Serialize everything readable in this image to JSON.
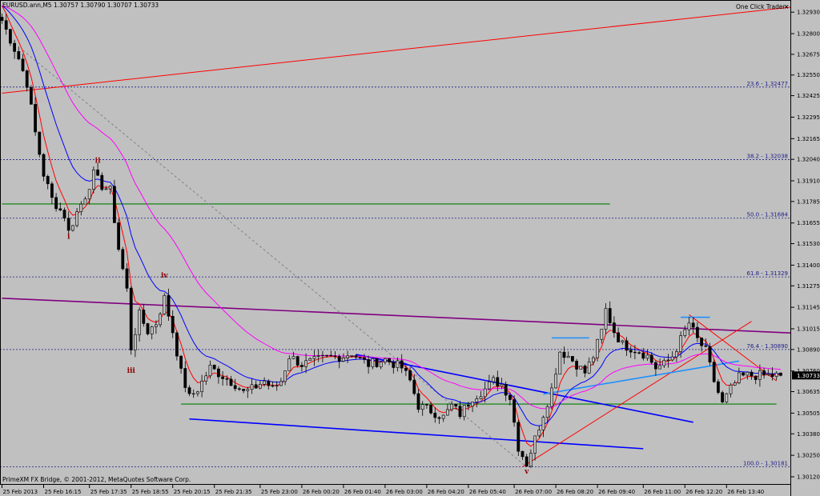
{
  "header": {
    "symbol_info": "EURUSD.ann,M5  1.30757 1.30790 1.30707 1.30733",
    "one_click_trader": "One Click Trader",
    "close_glyph": "×"
  },
  "footer": {
    "copyright": "PrimeXM FX Bridge, © 2001-2012, MetaQuotes Software Corp."
  },
  "colors": {
    "background": "#c0c0c0",
    "candle": "#000000",
    "ma_fast": "#ff0000",
    "ma_mid": "#0000ff",
    "ma_slow": "#ff00ff",
    "horizontal_green": "#008000",
    "purple_trend": "#800080",
    "red_trend": "#ff0000",
    "blue_trend": "#0000ff",
    "cyan": "#1e90ff",
    "fib_level": "#1c1c8c",
    "price_tag": "#000000"
  },
  "chart_data": {
    "type": "candlestick",
    "ylim": [
      1.3012,
      1.3296
    ],
    "x_range": [
      0,
      187
    ],
    "price_ticks": [
      "1.32930",
      "1.32800",
      "1.32675",
      "1.32550",
      "1.32425",
      "1.32295",
      "1.32165",
      "1.32040",
      "1.31910",
      "1.31785",
      "1.31655",
      "1.31530",
      "1.31400",
      "1.31275",
      "1.31145",
      "1.31015",
      "1.30890",
      "1.30760",
      "1.30635",
      "1.30505",
      "1.30380",
      "1.30250",
      "1.30120"
    ],
    "current_price": "1.30733",
    "time_ticks": [
      {
        "i": 0,
        "label": "25 Feb 2013"
      },
      {
        "i": 10,
        "label": "25 Feb 16:15"
      },
      {
        "i": 21,
        "label": "25 Feb 17:35"
      },
      {
        "i": 31,
        "label": "25 Feb 18:55"
      },
      {
        "i": 41,
        "label": "25 Feb 20:15"
      },
      {
        "i": 51,
        "label": "25 Feb 21:35"
      },
      {
        "i": 62,
        "label": "25 Feb 23:00"
      },
      {
        "i": 72,
        "label": "26 Feb 00:20"
      },
      {
        "i": 82,
        "label": "26 Feb 01:40"
      },
      {
        "i": 92,
        "label": "26 Feb 03:00"
      },
      {
        "i": 102,
        "label": "26 Feb 04:20"
      },
      {
        "i": 112,
        "label": "26 Feb 05:40"
      },
      {
        "i": 123,
        "label": "26 Feb 07:00"
      },
      {
        "i": 133,
        "label": "26 Feb 08:20"
      },
      {
        "i": 143,
        "label": "26 Feb 09:40"
      },
      {
        "i": 154,
        "label": "26 Feb 11:00"
      },
      {
        "i": 164,
        "label": "26 Feb 12:20"
      },
      {
        "i": 174,
        "label": "26 Feb 13:40"
      }
    ],
    "fib_levels": [
      {
        "label": "23.6 - 1.32477",
        "price": 1.32477
      },
      {
        "label": "38.2 - 1.32038",
        "price": 1.32038
      },
      {
        "label": "50.0 - 1.31684",
        "price": 1.31684
      },
      {
        "label": "61.8 - 1.31329",
        "price": 1.31329
      },
      {
        "label": "76.4 - 1.30890",
        "price": 1.3089
      },
      {
        "label": "100.0 - 1.30181",
        "price": 1.30181
      }
    ],
    "horizontal_lines": [
      {
        "name": "green-resistance",
        "price": 1.3177,
        "i_start": 0,
        "i_end": 146
      },
      {
        "name": "green-support",
        "price": 1.3056,
        "i_start": 43,
        "i_end": 186
      }
    ],
    "trend_lines": [
      {
        "name": "red-long-trend",
        "i1": 0,
        "p1": 1.3244,
        "i2": 200,
        "p2": 1.3296,
        "color": "ma_fast"
      },
      {
        "name": "purple-trend",
        "i1": 0,
        "p1": 1.312,
        "i2": 200,
        "p2": 1.3099,
        "color": "ma_slow_dark"
      },
      {
        "name": "blue-channel-upper",
        "i1": 85,
        "p1": 1.3086,
        "i2": 166,
        "p2": 1.3045,
        "color": "blue"
      },
      {
        "name": "blue-channel-lower",
        "i1": 45,
        "p1": 1.3047,
        "i2": 154,
        "p2": 1.3029,
        "color": "blue"
      },
      {
        "name": "red-rising-trend",
        "i1": 125,
        "p1": 1.3018,
        "i2": 180,
        "p2": 1.3106,
        "color": "red"
      },
      {
        "name": "red-falling-trend",
        "i1": 165,
        "p1": 1.311,
        "i2": 186,
        "p2": 1.307,
        "color": "red"
      },
      {
        "name": "cyan-trend",
        "i1": 130,
        "p1": 1.3062,
        "i2": 177,
        "p2": 1.3082,
        "color": "cyan"
      },
      {
        "name": "cyan-top-left",
        "i1": 132,
        "p1": 1.3096,
        "i2": 141,
        "p2": 1.3096,
        "color": "cyan"
      },
      {
        "name": "cyan-top-right",
        "i1": 163,
        "p1": 1.31085,
        "i2": 170,
        "p2": 1.31085,
        "color": "cyan"
      },
      {
        "name": "fib-dotted-diagonal",
        "i1": 5,
        "p1": 1.327,
        "i2": 126,
        "p2": 1.3018,
        "color": "gray"
      }
    ],
    "wave_labels": [
      {
        "text": "ii",
        "i": 23,
        "price": 1.3202
      },
      {
        "text": "i",
        "i": 16,
        "price": 1.3156
      },
      {
        "text": "iv",
        "i": 39,
        "price": 1.31325
      },
      {
        "text": "iii",
        "i": 31,
        "price": 1.3075
      },
      {
        "text": "v",
        "i": 126,
        "price": 1.3014
      }
    ],
    "anchors": [
      [
        0,
        1.3288
      ],
      [
        4,
        1.3265
      ],
      [
        6,
        1.325
      ],
      [
        8,
        1.322
      ],
      [
        10,
        1.3195
      ],
      [
        12,
        1.318
      ],
      [
        15,
        1.317
      ],
      [
        16,
        1.316
      ],
      [
        18,
        1.3172
      ],
      [
        20,
        1.3182
      ],
      [
        22,
        1.3195
      ],
      [
        24,
        1.3188
      ],
      [
        26,
        1.3185
      ],
      [
        28,
        1.315
      ],
      [
        30,
        1.3125
      ],
      [
        31,
        1.309
      ],
      [
        33,
        1.311
      ],
      [
        35,
        1.31
      ],
      [
        37,
        1.3105
      ],
      [
        39,
        1.312
      ],
      [
        41,
        1.31
      ],
      [
        43,
        1.3075
      ],
      [
        45,
        1.306
      ],
      [
        47,
        1.3065
      ],
      [
        50,
        1.3078
      ],
      [
        53,
        1.3073
      ],
      [
        56,
        1.3068
      ],
      [
        58,
        1.3063
      ],
      [
        60,
        1.3065
      ],
      [
        63,
        1.307
      ],
      [
        65,
        1.3065
      ],
      [
        67,
        1.307
      ],
      [
        69,
        1.3085
      ],
      [
        72,
        1.308
      ],
      [
        75,
        1.3082
      ],
      [
        78,
        1.3084
      ],
      [
        82,
        1.3085
      ],
      [
        84,
        1.3087
      ],
      [
        86,
        1.3083
      ],
      [
        88,
        1.308
      ],
      [
        92,
        1.3083
      ],
      [
        96,
        1.3078
      ],
      [
        98,
        1.307
      ],
      [
        100,
        1.3055
      ],
      [
        103,
        1.3052
      ],
      [
        106,
        1.3048
      ],
      [
        108,
        1.3055
      ],
      [
        110,
        1.305
      ],
      [
        113,
        1.306
      ],
      [
        116,
        1.3065
      ],
      [
        118,
        1.307
      ],
      [
        120,
        1.3068
      ],
      [
        122,
        1.306
      ],
      [
        124,
        1.303
      ],
      [
        126,
        1.302
      ],
      [
        128,
        1.3035
      ],
      [
        130,
        1.305
      ],
      [
        132,
        1.3065
      ],
      [
        134,
        1.3088
      ],
      [
        136,
        1.3085
      ],
      [
        138,
        1.308
      ],
      [
        140,
        1.3075
      ],
      [
        142,
        1.3085
      ],
      [
        144,
        1.31
      ],
      [
        145,
        1.3113
      ],
      [
        147,
        1.31
      ],
      [
        149,
        1.3092
      ],
      [
        151,
        1.309
      ],
      [
        153,
        1.3088
      ],
      [
        155,
        1.3085
      ],
      [
        157,
        1.3078
      ],
      [
        159,
        1.308
      ],
      [
        161,
        1.3085
      ],
      [
        163,
        1.3095
      ],
      [
        165,
        1.3105
      ],
      [
        167,
        1.3095
      ],
      [
        169,
        1.3088
      ],
      [
        171,
        1.307
      ],
      [
        173,
        1.3056
      ],
      [
        175,
        1.3065
      ],
      [
        177,
        1.3072
      ],
      [
        179,
        1.30733
      ]
    ]
  }
}
